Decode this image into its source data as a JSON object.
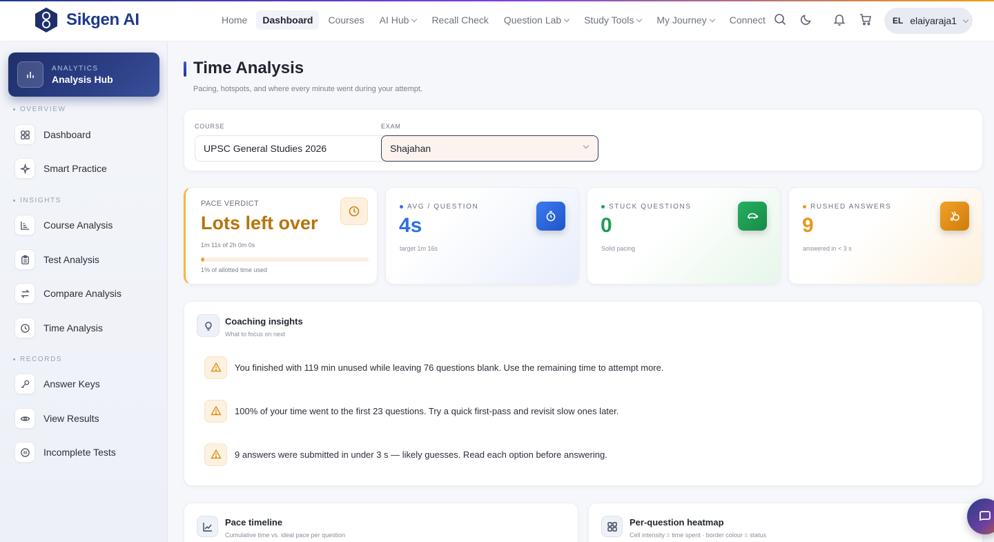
{
  "brand": {
    "name": "Sikgen AI"
  },
  "nav": {
    "items": [
      {
        "label": "Home",
        "dropdown": false,
        "active": false
      },
      {
        "label": "Dashboard",
        "dropdown": false,
        "active": true
      },
      {
        "label": "Courses",
        "dropdown": false,
        "active": false
      },
      {
        "label": "AI Hub",
        "dropdown": true,
        "active": false
      },
      {
        "label": "Recall Check",
        "dropdown": false,
        "active": false
      },
      {
        "label": "Question Lab",
        "dropdown": true,
        "active": false
      },
      {
        "label": "Study Tools",
        "dropdown": true,
        "active": false
      },
      {
        "label": "My Journey",
        "dropdown": true,
        "active": false
      },
      {
        "label": "Connect",
        "dropdown": false,
        "active": false
      }
    ],
    "icons": [
      "search-icon",
      "moon-icon",
      "bell-icon",
      "cart-icon"
    ]
  },
  "user": {
    "initials": "EL",
    "name": "elaiyaraja1"
  },
  "sidebar": {
    "hub": {
      "kicker": "ANALYTICS",
      "title": "Analysis Hub"
    },
    "sections": {
      "overview": "OVERVIEW",
      "insights": "INSIGHTS",
      "records": "RECORDS"
    },
    "items": {
      "dashboard": "Dashboard",
      "smart_practice": "Smart Practice",
      "course_analysis": "Course Analysis",
      "test_analysis": "Test Analysis",
      "compare_analysis": "Compare Analysis",
      "time_analysis": "Time Analysis",
      "answer_keys": "Answer Keys",
      "view_results": "View Results",
      "incomplete_tests": "Incomplete Tests"
    }
  },
  "page": {
    "title": "Time Analysis",
    "subtitle": "Pacing, hotspots, and where every minute went during your attempt."
  },
  "filters": {
    "course_label": "COURSE",
    "course_value": "UPSC General Studies 2026",
    "exam_label": "EXAM",
    "exam_value": "Shajahan"
  },
  "verdict": {
    "kicker": "PACE VERDICT",
    "title": "Lots left over",
    "meta": "1m 11s of 2h 0m 0s",
    "used_fraction": 0.01,
    "note": "1% of allotted time used"
  },
  "stats": {
    "avg": {
      "kicker": "AVG / QUESTION",
      "value": "4s",
      "note": "target 1m 16s",
      "color": "#2f6fe4"
    },
    "stuck": {
      "kicker": "STUCK QUESTIONS",
      "value": "0",
      "note": "Solid pacing",
      "color": "#1f9d55"
    },
    "rushed": {
      "kicker": "RUSHED ANSWERS",
      "value": "9",
      "note": "answered in < 3 s",
      "color": "#e59a1f"
    }
  },
  "coaching": {
    "title": "Coaching insights",
    "subtitle": "What to focus on next",
    "insights": [
      "You finished with 119 min unused while leaving 76 questions blank. Use the remaining time to attempt more.",
      "100% of your time went to the first 23 questions. Try a quick first-pass and revisit slow ones later.",
      "9 answers were submitted in under 3 s — likely guesses. Read each option before answering."
    ]
  },
  "bottom": {
    "timeline": {
      "title": "Pace timeline",
      "subtitle": "Cumulative time vs. ideal pace per question"
    },
    "heatmap": {
      "title": "Per-question heatmap",
      "subtitle": "Cell intensity = time spent · border colour = status"
    }
  }
}
